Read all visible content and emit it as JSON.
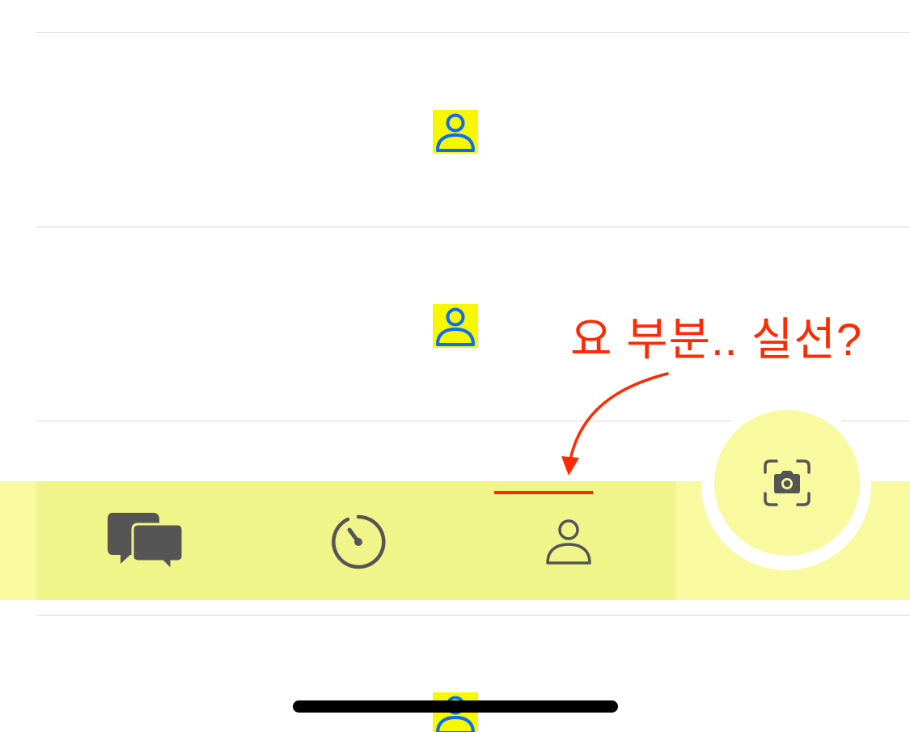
{
  "annotation": {
    "text": "요 부분.. 실선?",
    "color": "#ff2a00"
  },
  "list": {
    "rows": [
      {
        "avatar_icon": "person-outline-icon"
      },
      {
        "avatar_icon": "person-outline-icon"
      },
      {
        "avatar_icon": "person-outline-icon"
      }
    ]
  },
  "tabbar": {
    "background": "#f9f9a0",
    "tabs": [
      {
        "icon": "chat-bubbles-icon",
        "selected": false
      },
      {
        "icon": "timer-icon",
        "selected": false
      },
      {
        "icon": "person-outline-icon",
        "selected": true
      }
    ],
    "camera_button_icon": "camera-scan-icon"
  },
  "colors": {
    "accent_yellow": "#f7f700",
    "avatar_blue": "#0a6cff",
    "icon_gray": "#555555",
    "indicator_red": "#ff2a00"
  }
}
